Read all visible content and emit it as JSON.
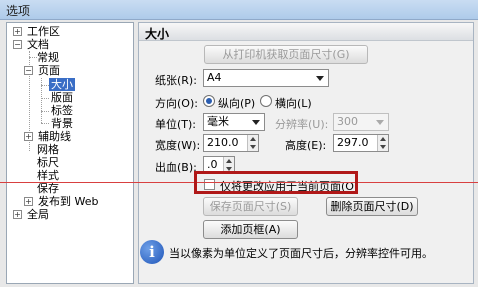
{
  "window": {
    "title": "选项"
  },
  "tree": {
    "items": [
      {
        "label": "工作区",
        "expander": "+"
      },
      {
        "label": "文档",
        "expander": "−"
      },
      {
        "label": "常规"
      },
      {
        "label": "页面",
        "expander": "−"
      },
      {
        "label": "大小",
        "selected": true
      },
      {
        "label": "版面"
      },
      {
        "label": "标签"
      },
      {
        "label": "背景"
      },
      {
        "label": "辅助线",
        "expander": "+"
      },
      {
        "label": "网格"
      },
      {
        "label": "标尺"
      },
      {
        "label": "样式"
      },
      {
        "label": "保存"
      },
      {
        "label": "发布到 Web",
        "expander": "+"
      },
      {
        "label": "全局",
        "expander": "+"
      }
    ]
  },
  "panel": {
    "title": "大小",
    "get_from_printer_button": "从打印机获取页面尺寸(G)",
    "paper": {
      "label": "纸张(R):",
      "value": "A4"
    },
    "orientation": {
      "label": "方向(O):",
      "portrait": "纵向(P)",
      "landscape": "横向(L)",
      "selected": "portrait"
    },
    "unit": {
      "label": "单位(T):",
      "value": "毫米"
    },
    "resolution": {
      "label": "分辨率(U):",
      "value": "300"
    },
    "width": {
      "label": "宽度(W):",
      "value": "210.0"
    },
    "height": {
      "label": "高度(E):",
      "value": "297.0"
    },
    "bleed": {
      "label": "出血(B):",
      "value": ".0"
    },
    "apply_current_only": {
      "label": "仅将更改应用于当前页面(O)",
      "checked": false
    },
    "save_page_size_button": "保存页面尺寸(S)",
    "delete_page_size_button": "删除页面尺寸(D)",
    "add_page_frame_button": "添加页框(A)",
    "info_text": "当以像素为单位定义了页面尺寸后，分辨率控件可用。"
  },
  "colors": {
    "highlight": "#3a6ec6",
    "annotation_red": "#b01818",
    "guide_red": "#d84040"
  }
}
